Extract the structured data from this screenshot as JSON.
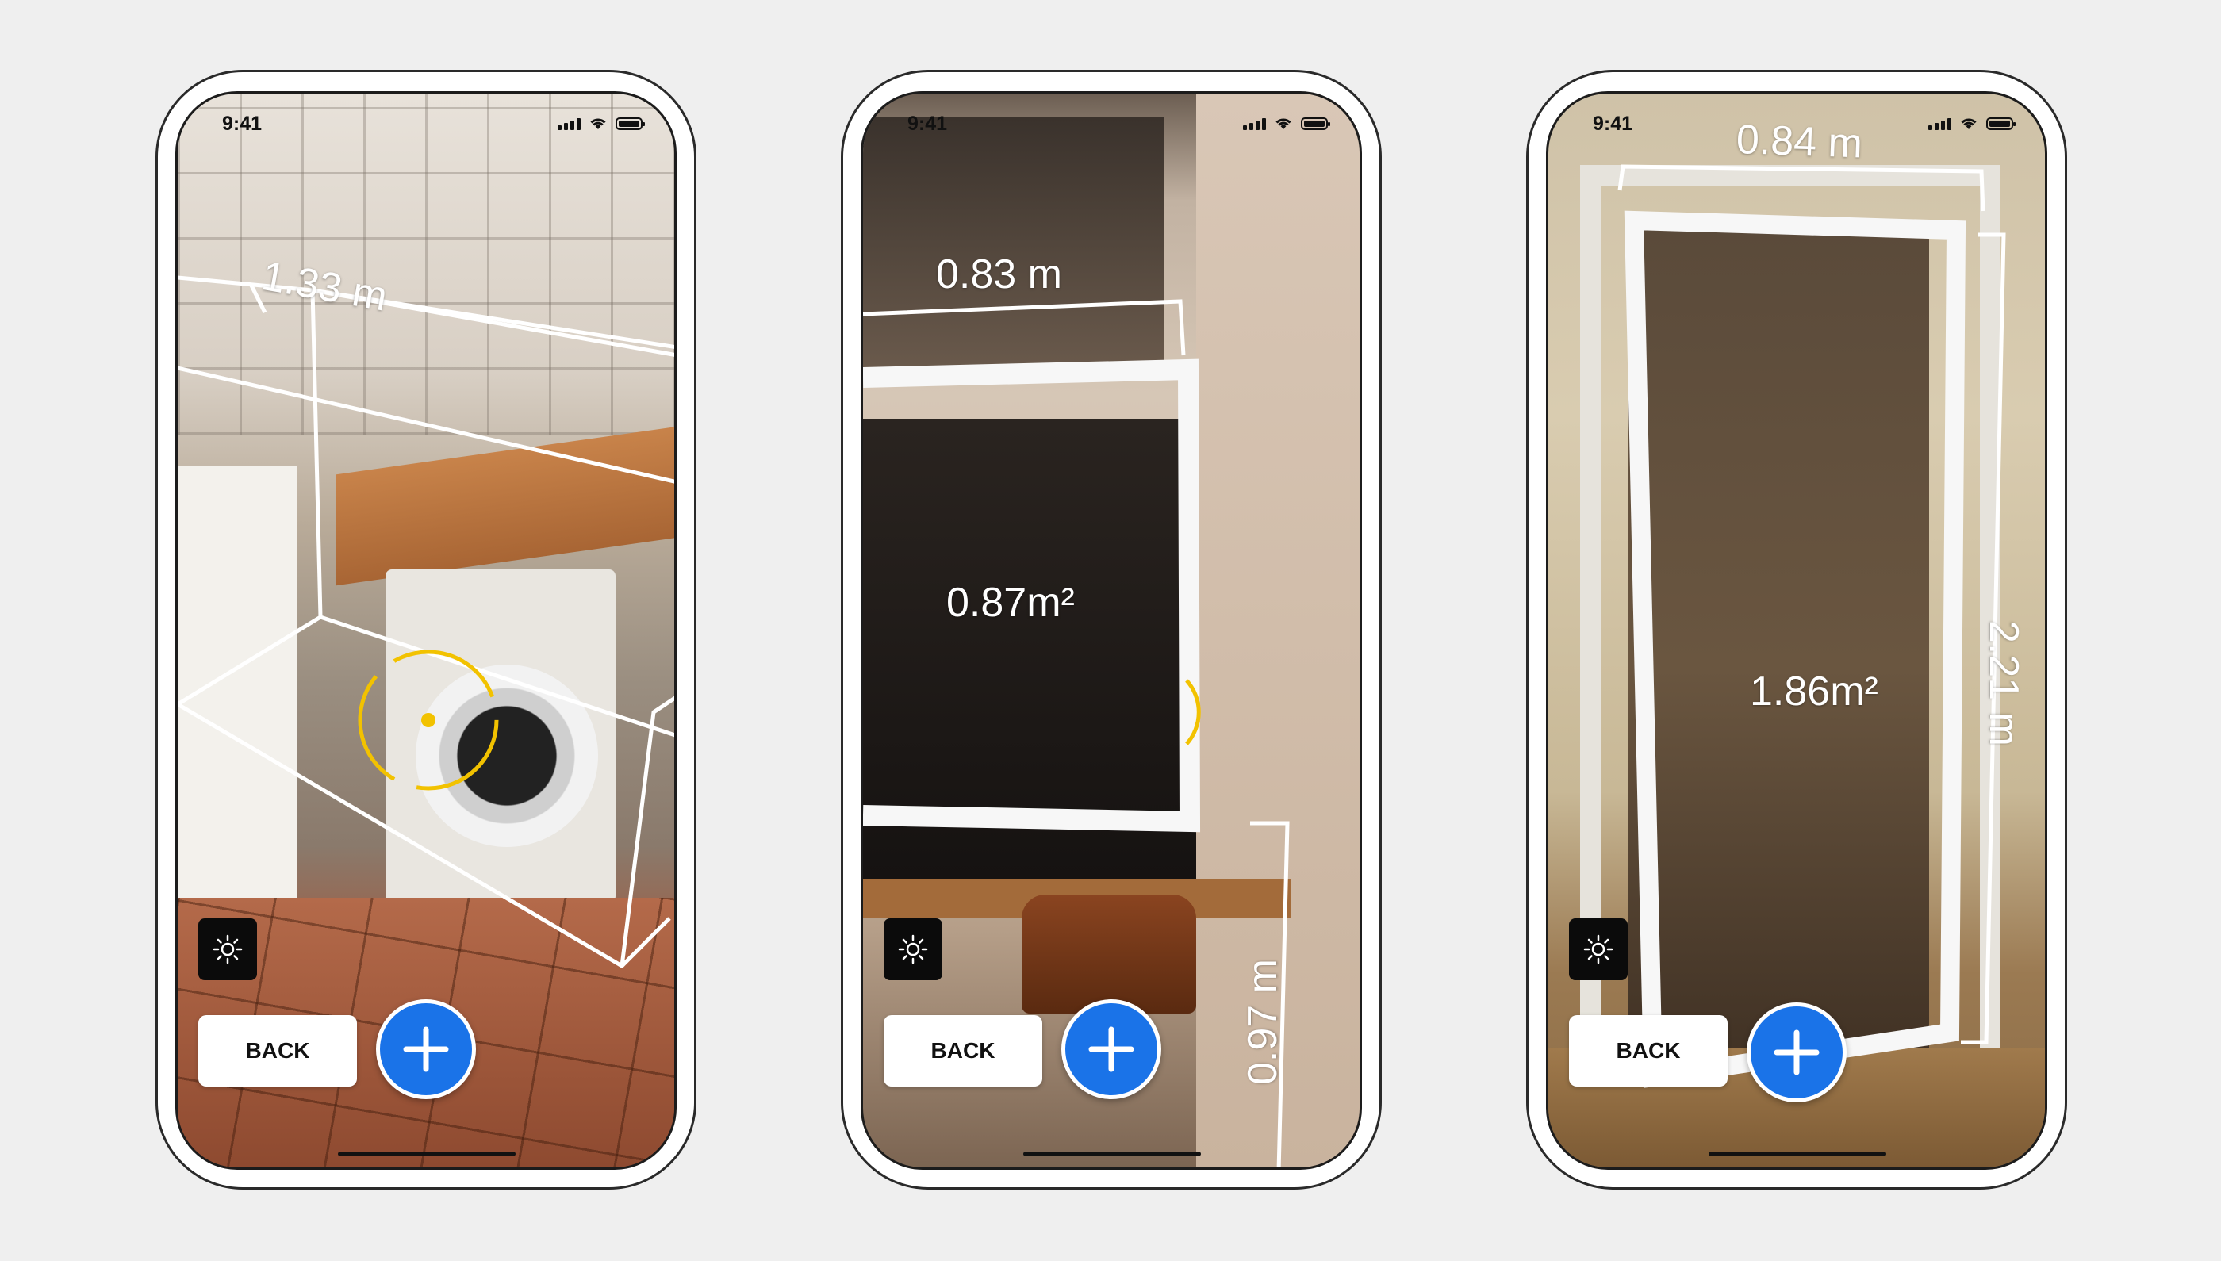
{
  "colors": {
    "page_bg": "#efefef",
    "accent": "#1a73e8",
    "reticle": "#f2c200"
  },
  "screens": [
    {
      "status_time": "9:41",
      "measurements": [
        "1.33 m"
      ],
      "light_icon": "sun-icon",
      "back_label": "BACK",
      "add_icon": "plus-icon"
    },
    {
      "status_time": "9:41",
      "measurements": [
        "0.83 m",
        "0.87m²",
        "0.97 m"
      ],
      "light_icon": "sun-icon",
      "back_label": "BACK",
      "add_icon": "plus-icon"
    },
    {
      "status_time": "9:41",
      "measurements": [
        "0.84 m",
        "1.86m²",
        "2.21 m"
      ],
      "light_icon": "sun-icon",
      "back_label": "BACK",
      "add_icon": "plus-icon"
    }
  ]
}
